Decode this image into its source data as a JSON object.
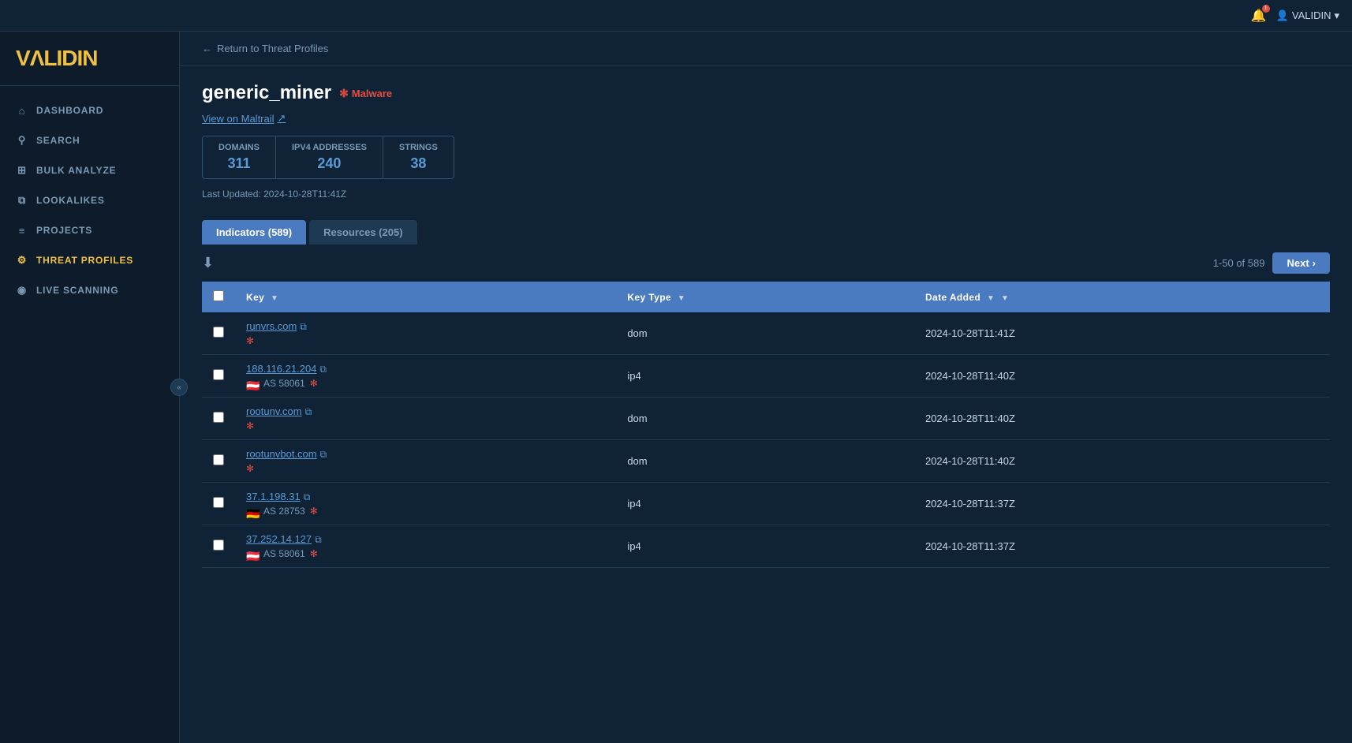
{
  "topbar": {
    "user_label": "VALIDIN",
    "dropdown_arrow": "▾"
  },
  "sidebar": {
    "logo": "VΛLIDIN",
    "logo_v": "V",
    "logo_rest": "ΛLIDIN",
    "items": [
      {
        "id": "dashboard",
        "label": "Dashboard",
        "icon": "⌂",
        "active": false
      },
      {
        "id": "search",
        "label": "Search",
        "icon": "🔍",
        "active": false
      },
      {
        "id": "bulk-analyze",
        "label": "Bulk Analyze",
        "icon": "⊞",
        "active": false
      },
      {
        "id": "lookalikes",
        "label": "Lookalikes",
        "icon": "⧉",
        "active": false
      },
      {
        "id": "projects",
        "label": "Projects",
        "icon": "≡",
        "active": false
      },
      {
        "id": "threat-profiles",
        "label": "Threat Profiles",
        "icon": "⚙",
        "active": true
      },
      {
        "id": "live-scanning",
        "label": "Live Scanning",
        "icon": "◉",
        "active": false
      }
    ],
    "collapse_icon": "«"
  },
  "breadcrumb": {
    "arrow": "←",
    "label": "Return to Threat Profiles"
  },
  "page": {
    "title": "generic_miner",
    "badge_star": "✻",
    "badge_label": "Malware",
    "maltrail_label": "View on Maltrail",
    "maltrail_icon": "↗",
    "last_updated_label": "Last Updated:",
    "last_updated_value": "2024-10-28T11:41Z",
    "stats": {
      "domains_label": "Domains",
      "domains_value": "311",
      "ipv4_label": "IPv4 Addresses",
      "ipv4_value": "240",
      "strings_label": "Strings",
      "strings_value": "38"
    }
  },
  "tabs": [
    {
      "id": "indicators",
      "label": "Indicators (589)",
      "active": true
    },
    {
      "id": "resources",
      "label": "Resources (205)",
      "active": false
    }
  ],
  "table": {
    "download_icon": "⬇",
    "pagination": {
      "range": "1-50 of 589",
      "next_label": "Next",
      "next_arrow": "›"
    },
    "columns": [
      {
        "id": "checkbox",
        "label": ""
      },
      {
        "id": "key",
        "label": "Key",
        "filter": true
      },
      {
        "id": "key_type",
        "label": "Key Type",
        "filter": true
      },
      {
        "id": "date_added",
        "label": "Date Added",
        "filter": true,
        "sort": true
      }
    ],
    "rows": [
      {
        "key": "runvrs.com",
        "key_link": true,
        "copy": true,
        "sub_star": true,
        "sub_flag": null,
        "sub_as": null,
        "key_type": "dom",
        "date_added": "2024-10-28T11:41Z"
      },
      {
        "key": "188.116.21.204",
        "key_link": true,
        "copy": true,
        "sub_star": true,
        "sub_flag": "🇦🇹",
        "sub_as": "AS 58061",
        "key_type": "ip4",
        "date_added": "2024-10-28T11:40Z"
      },
      {
        "key": "rootunv.com",
        "key_link": true,
        "copy": true,
        "sub_star": true,
        "sub_flag": null,
        "sub_as": null,
        "key_type": "dom",
        "date_added": "2024-10-28T11:40Z"
      },
      {
        "key": "rootunvbot.com",
        "key_link": true,
        "copy": true,
        "sub_star": true,
        "sub_flag": null,
        "sub_as": null,
        "key_type": "dom",
        "date_added": "2024-10-28T11:40Z"
      },
      {
        "key": "37.1.198.31",
        "key_link": true,
        "copy": true,
        "sub_star": true,
        "sub_flag": "🇩🇪",
        "sub_as": "AS 28753",
        "key_type": "ip4",
        "date_added": "2024-10-28T11:37Z"
      },
      {
        "key": "37.252.14.127",
        "key_link": true,
        "copy": true,
        "sub_star": true,
        "sub_flag": "🇦🇹",
        "sub_as": "AS 58061",
        "key_type": "ip4",
        "date_added": "2024-10-28T11:37Z"
      }
    ]
  }
}
